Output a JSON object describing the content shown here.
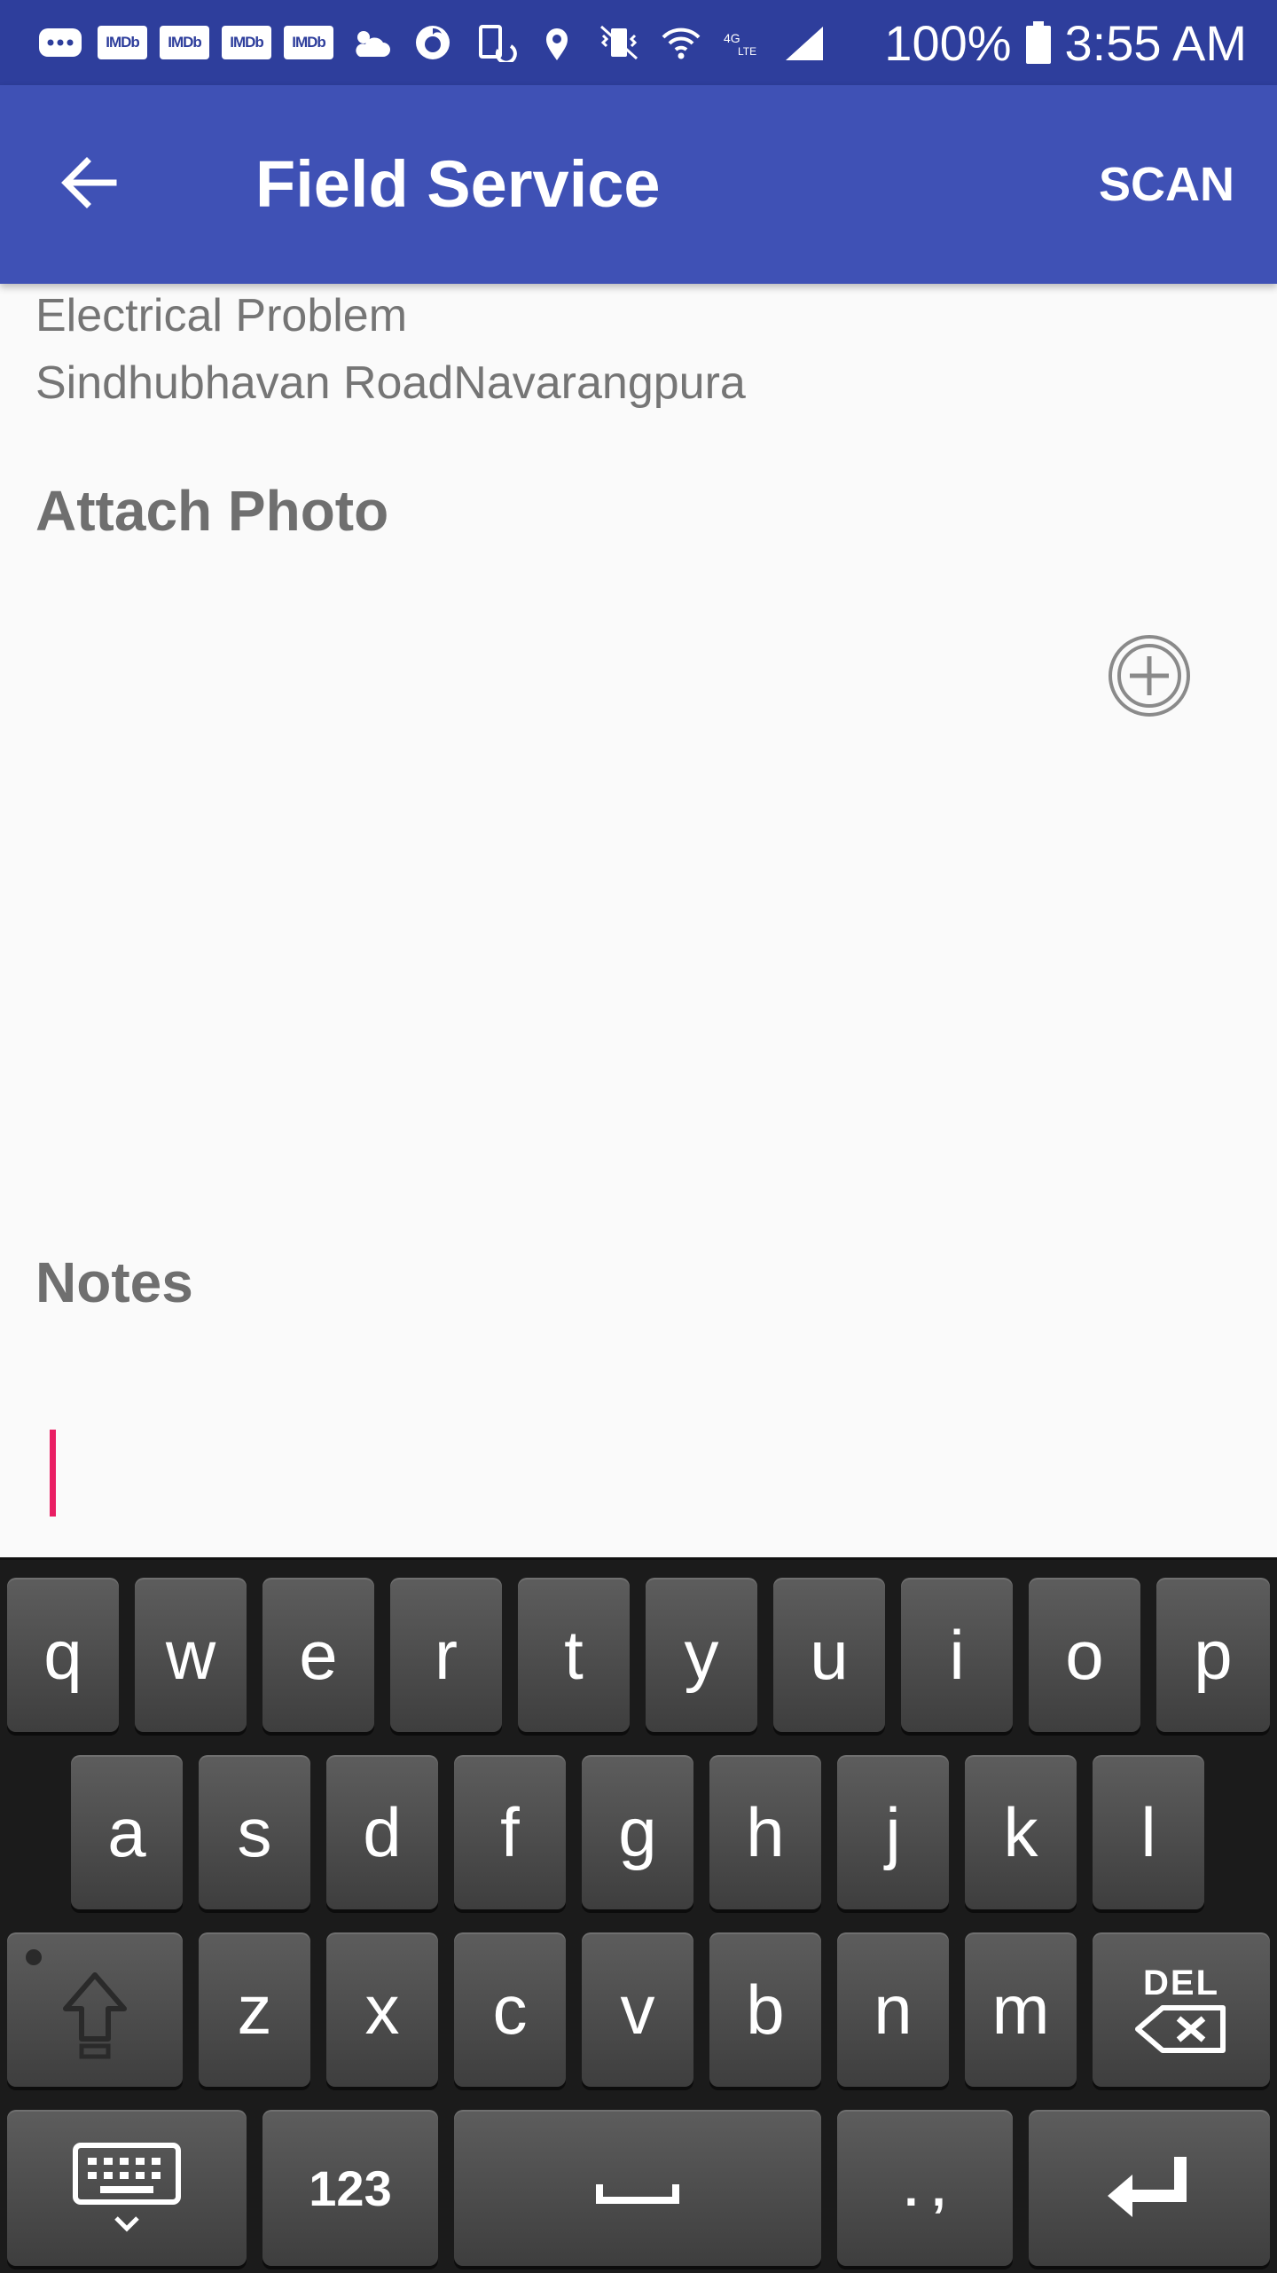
{
  "status_bar": {
    "icons": [
      "messenger-icon",
      "imdb-icon",
      "imdb-icon",
      "imdb-icon",
      "imdb-icon",
      "weather-icon",
      "vodafone-icon",
      "screen-rotate-icon",
      "location-icon",
      "vibrate-icon",
      "wifi-icon",
      "volte-icon",
      "signal-icon"
    ],
    "imdb_label": "IMDb",
    "battery": "100%",
    "time": "3:55 AM"
  },
  "app_bar": {
    "title": "Field Service",
    "scan_label": "SCAN",
    "color": "#3f51b5"
  },
  "issue": {
    "category": "Electrical Problem",
    "address": "Sindhubhavan RoadNavarangpura"
  },
  "attach_photo": {
    "title": "Attach Photo"
  },
  "notes": {
    "title": "Notes",
    "value": ""
  },
  "keyboard": {
    "row1": [
      "q",
      "w",
      "e",
      "r",
      "t",
      "y",
      "u",
      "i",
      "o",
      "p"
    ],
    "row2": [
      "a",
      "s",
      "d",
      "f",
      "g",
      "h",
      "j",
      "k",
      "l"
    ],
    "row3": [
      "z",
      "x",
      "c",
      "v",
      "b",
      "n",
      "m"
    ],
    "del_label": "DEL",
    "numbers_label": "123",
    "punct_label": ". ,"
  }
}
